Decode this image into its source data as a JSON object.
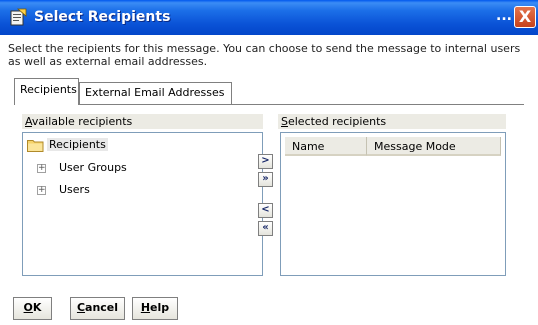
{
  "window": {
    "title": "Select Recipients",
    "ellipsis": "...",
    "close_glyph": "X",
    "icon": "app-icon"
  },
  "instructions": "Select the recipients for this message. You can choose to send the message to internal users as well as external email addresses.",
  "tabs": [
    {
      "label": "Recipients",
      "active": true
    },
    {
      "label": "External Email Addresses",
      "active": false
    }
  ],
  "available": {
    "label_first": "A",
    "label_rest": "vailable recipients",
    "tree": [
      {
        "label": "Recipients",
        "icon": "folder-icon"
      },
      {
        "label": "User Groups",
        "expander": "+"
      },
      {
        "label": "Users",
        "expander": "+"
      }
    ]
  },
  "selected": {
    "label_first": "S",
    "label_rest": "elected recipients",
    "columns": [
      "Name",
      "Message Mode"
    ]
  },
  "move_buttons": {
    "add_one": ">",
    "add_all": "»",
    "remove_one": "<",
    "remove_all": "«"
  },
  "footer": {
    "ok_first": "O",
    "ok_rest": "K",
    "cancel_first": "C",
    "cancel_rest": "ancel",
    "help_first": "H",
    "help_rest": "elp"
  },
  "colors": {
    "titlebar": "#0a52d6",
    "close": "#c8421c",
    "panel_header": "#ecebe4",
    "list_border": "#7f9db9"
  }
}
